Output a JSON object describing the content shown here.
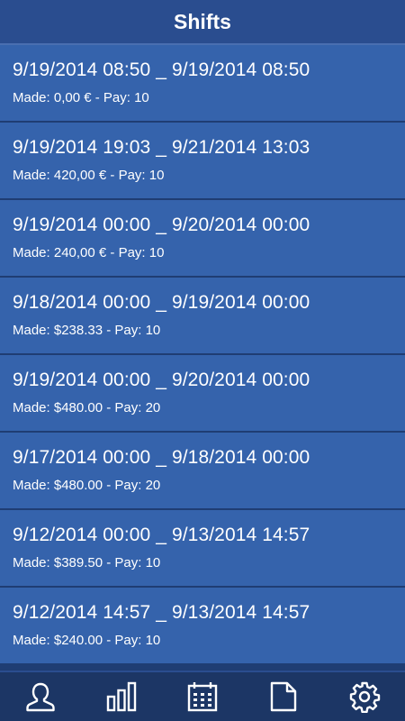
{
  "header": {
    "title": "Shifts"
  },
  "shifts": [
    {
      "range": "9/19/2014 08:50 _ 9/19/2014 08:50",
      "summary": "Made: 0,00 € - Pay: 10"
    },
    {
      "range": "9/19/2014 19:03 _ 9/21/2014 13:03",
      "summary": "Made: 420,00 € - Pay: 10"
    },
    {
      "range": "9/19/2014 00:00 _ 9/20/2014 00:00",
      "summary": "Made: 240,00 € - Pay: 10"
    },
    {
      "range": "9/18/2014 00:00 _ 9/19/2014 00:00",
      "summary": "Made: $238.33 - Pay: 10"
    },
    {
      "range": "9/19/2014 00:00 _ 9/20/2014 00:00",
      "summary": "Made: $480.00 - Pay: 20"
    },
    {
      "range": "9/17/2014 00:00 _ 9/18/2014 00:00",
      "summary": "Made: $480.00 - Pay: 20"
    },
    {
      "range": "9/12/2014 00:00 _ 9/13/2014 14:57",
      "summary": "Made: $389.50 - Pay: 10"
    },
    {
      "range": "9/12/2014 14:57 _ 9/13/2014 14:57",
      "summary": "Made: $240.00 - Pay: 10"
    }
  ],
  "tabs": [
    {
      "icon": "person-icon"
    },
    {
      "icon": "bar-chart-icon"
    },
    {
      "icon": "calendar-icon"
    },
    {
      "icon": "document-icon"
    },
    {
      "icon": "gear-icon"
    }
  ],
  "colors": {
    "header_bg": "#2a4d8f",
    "row_bg": "#3563ac",
    "divider": "#1f3d73",
    "tabbar_bg": "#1c3665",
    "text": "#ffffff"
  }
}
